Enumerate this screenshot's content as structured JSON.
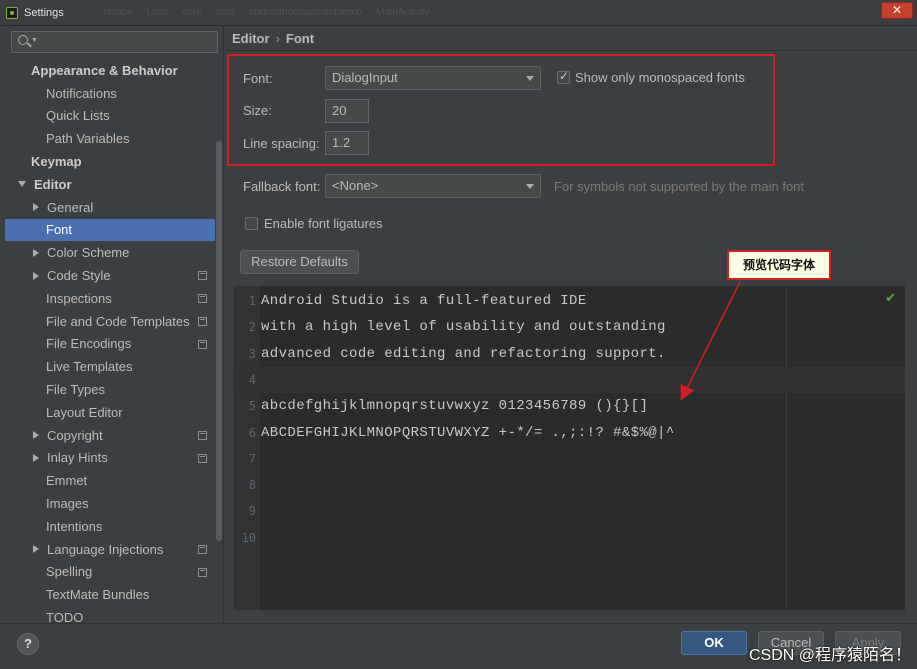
{
  "window": {
    "title": "Settings",
    "blurred_tabs": [
      "hlsaps",
      "Lsoa",
      "core",
      "ttest",
      "androidhcomponentdemo",
      "MainActivity"
    ],
    "close_label": "✕"
  },
  "sidebar": {
    "search_placeholder": "",
    "items": [
      {
        "label": "Appearance & Behavior",
        "level": 0,
        "bold": true,
        "arrow": "none"
      },
      {
        "label": "Notifications",
        "level": 1
      },
      {
        "label": "Quick Lists",
        "level": 1
      },
      {
        "label": "Path Variables",
        "level": 1
      },
      {
        "label": "Keymap",
        "level": 0,
        "bold": true
      },
      {
        "label": "Editor",
        "level": 0,
        "bold": true,
        "arrow": "down"
      },
      {
        "label": "General",
        "level": 1,
        "arrow": "right"
      },
      {
        "label": "Font",
        "level": 1,
        "selected": true
      },
      {
        "label": "Color Scheme",
        "level": 1,
        "arrow": "right"
      },
      {
        "label": "Code Style",
        "level": 1,
        "arrow": "right",
        "project": true
      },
      {
        "label": "Inspections",
        "level": 1,
        "project": true
      },
      {
        "label": "File and Code Templates",
        "level": 1,
        "project": true
      },
      {
        "label": "File Encodings",
        "level": 1,
        "project": true
      },
      {
        "label": "Live Templates",
        "level": 1
      },
      {
        "label": "File Types",
        "level": 1
      },
      {
        "label": "Layout Editor",
        "level": 1
      },
      {
        "label": "Copyright",
        "level": 1,
        "arrow": "right",
        "project": true
      },
      {
        "label": "Inlay Hints",
        "level": 1,
        "arrow": "right",
        "project": true
      },
      {
        "label": "Emmet",
        "level": 1
      },
      {
        "label": "Images",
        "level": 1
      },
      {
        "label": "Intentions",
        "level": 1
      },
      {
        "label": "Language Injections",
        "level": 1,
        "arrow": "right",
        "project": true
      },
      {
        "label": "Spelling",
        "level": 1,
        "project": true
      },
      {
        "label": "TextMate Bundles",
        "level": 1
      },
      {
        "label": "TODO",
        "level": 1
      }
    ]
  },
  "breadcrumb": {
    "parent": "Editor",
    "separator": "›",
    "current": "Font"
  },
  "font_settings": {
    "font_label": "Font:",
    "font_value": "DialogInput",
    "monospaced_label": "Show only monospaced fonts",
    "monospaced_checked": true,
    "size_label": "Size:",
    "size_value": "20",
    "line_spacing_label": "Line spacing:",
    "line_spacing_value": "1.2",
    "fallback_label": "Fallback font:",
    "fallback_value": "<None>",
    "fallback_hint": "For symbols not supported by the main font",
    "ligatures_label": "Enable font ligatures",
    "ligatures_checked": false,
    "restore_label": "Restore Defaults"
  },
  "preview": {
    "lines": [
      {
        "n": "1",
        "text": "Android Studio is a full-featured IDE"
      },
      {
        "n": "2",
        "text": "with a high level of usability and outstanding"
      },
      {
        "n": "3",
        "text": "advanced code editing and refactoring support."
      },
      {
        "n": "4",
        "text": ""
      },
      {
        "n": "5",
        "text": "abcdefghijklmnopqrstuvwxyz 0123456789 (){}[]"
      },
      {
        "n": "6",
        "text": "ABCDEFGHIJKLMNOPQRSTUVWXYZ +-*/= .,;:!? #&$%@|^"
      },
      {
        "n": "7",
        "text": ""
      },
      {
        "n": "8",
        "text": ""
      },
      {
        "n": "9",
        "text": ""
      },
      {
        "n": "10",
        "text": ""
      }
    ],
    "status_icon": "check-icon"
  },
  "annotation": {
    "callout_text": "预览代码字体"
  },
  "footer": {
    "help_label": "?",
    "ok_label": "OK",
    "cancel_label": "Cancel",
    "apply_label": "Apply",
    "watermark": "CSDN @程序猿陌名！"
  },
  "colors": {
    "accent": "#4b6eaf",
    "ok_button": "#365880",
    "highlight_border": "#d21f1f"
  }
}
